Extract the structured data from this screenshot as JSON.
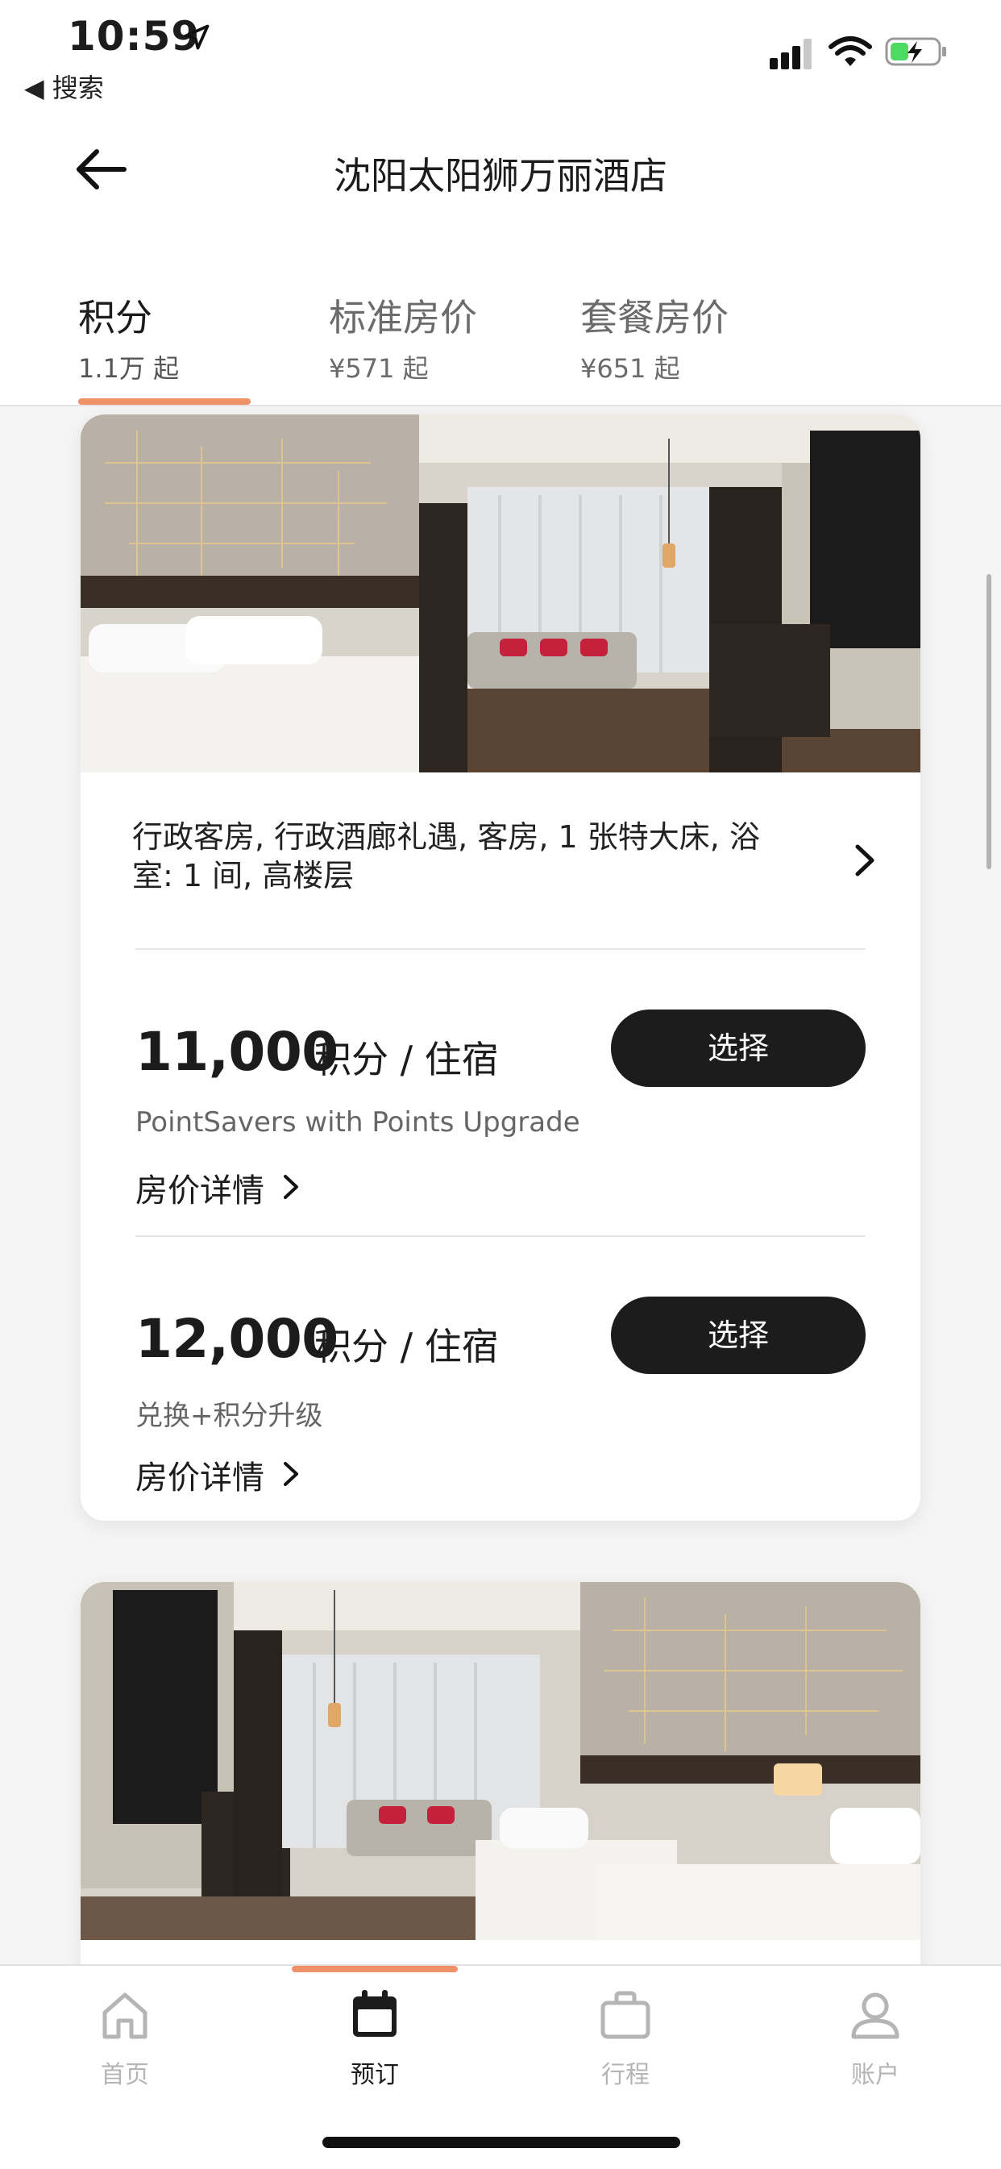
{
  "status_bar": {
    "time": "10:59",
    "back_app": "◀ 搜索"
  },
  "header": {
    "title": "沈阳太阳狮万丽酒店"
  },
  "tabs": [
    {
      "label": "积分",
      "sub": "1.1万 起"
    },
    {
      "label": "标准房价",
      "sub": "¥571 起"
    },
    {
      "label": "套餐房价",
      "sub": "¥651 起"
    }
  ],
  "room": {
    "description": "行政客房, 行政酒廊礼遇, 客房, 1 张特大床, 浴室: 1 间, 高楼层",
    "rates": [
      {
        "points": "11,000",
        "unit": "积分 / 住宿",
        "name": "PointSavers with Points Upgrade",
        "details": "房价详情",
        "select": "选择"
      },
      {
        "points": "12,000",
        "unit": "积分 / 住宿",
        "name": "兑换+积分升级",
        "details": "房价详情",
        "select": "选择"
      }
    ]
  },
  "bottom_nav": [
    {
      "label": "首页"
    },
    {
      "label": "预订"
    },
    {
      "label": "行程"
    },
    {
      "label": "账户"
    }
  ],
  "colors": {
    "accent": "#f0916a",
    "button": "#1c1c1c",
    "inactive_nav": "#b5b5b5"
  }
}
